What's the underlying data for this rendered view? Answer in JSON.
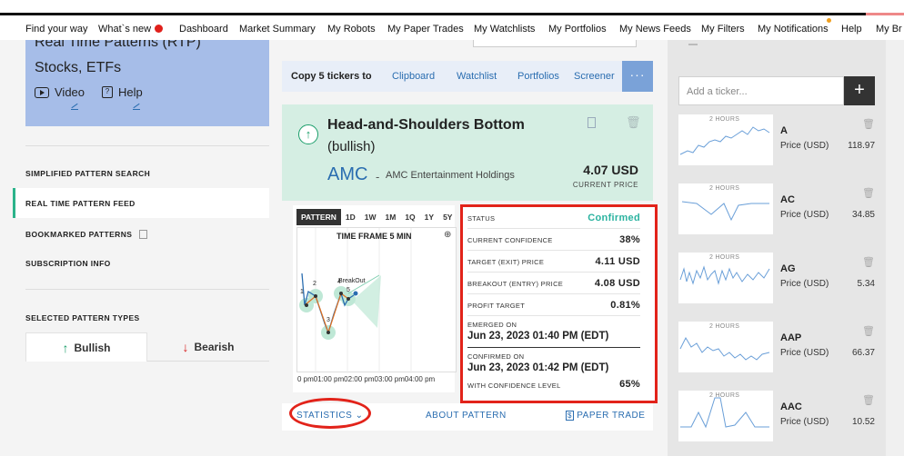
{
  "nav": {
    "items": [
      "Find your way",
      "What`s new",
      "Dashboard",
      "Market Summary",
      "My Robots",
      "My Paper Trades",
      "My Watchlists",
      "My Portfolios",
      "My News Feeds",
      "My Filters",
      "My Notifications",
      "Help",
      "My Br"
    ]
  },
  "left": {
    "card_title1": "Real Time Patterns (RTP)",
    "card_title2": "Stocks, ETFs",
    "video_label": "Video",
    "help_label": "Help",
    "menu": {
      "simplified": "SIMPLIFIED PATTERN SEARCH",
      "realtime": "REAL TIME PATTERN FEED",
      "bookmarked": "BOOKMARKED PATTERNS",
      "subscription": "SUBSCRIPTION INFO",
      "selected_types": "SELECTED PATTERN TYPES"
    },
    "bullish": "Bullish",
    "bearish": "Bearish"
  },
  "copybar": {
    "label": "Copy 5 tickers to",
    "links": [
      "Clipboard",
      "Watchlist",
      "Portfolios",
      "Screener"
    ],
    "more": "···"
  },
  "pattern": {
    "name": "Head-and-Shoulders Bottom",
    "direction": "(bullish)",
    "symbol": "AMC",
    "separator": "-",
    "company": "AMC Entertainment Holdings",
    "price": "4.07 USD",
    "price_label": "CURRENT PRICE"
  },
  "chart": {
    "tabs": [
      "PATTERN",
      "1D",
      "1W",
      "1M",
      "1Q",
      "1Y",
      "5Y"
    ],
    "selected_tab": "PATTERN",
    "timeframe": "TIME FRAME 5 MIN",
    "time_axis": "0 pm01:00 pm02:00 pm03:00 pm04:00 pm",
    "points": [
      "1",
      "2",
      "3",
      "4",
      "5"
    ],
    "breakout_label": "BreakOut"
  },
  "status": {
    "status_label": "STATUS",
    "status_value": "Confirmed",
    "confidence_label": "CURRENT CONFIDENCE",
    "confidence_value": "38%",
    "target_label": "TARGET (EXIT) PRICE",
    "target_value": "4.11 USD",
    "breakout_label": "BREAKOUT (ENTRY) PRICE",
    "breakout_value": "4.08 USD",
    "profit_label": "PROFIT TARGET",
    "profit_value": "0.81%",
    "emerged_label": "EMERGED ON",
    "emerged_value": "Jun 23, 2023 01:40 PM (EDT)",
    "confirmed_label": "CONFIRMED ON",
    "confirmed_value": "Jun 23, 2023 01:42 PM (EDT)",
    "conf_level_label": "WITH CONFIDENCE LEVEL",
    "conf_level_value": "65%"
  },
  "bottom": {
    "statistics": "STATISTICS",
    "about": "ABOUT PATTERN",
    "paper_trade": "PAPER TRADE"
  },
  "right": {
    "add_placeholder": "Add a ticker...",
    "add_button": "+",
    "price_label": "Price (USD)",
    "hours_label": "2 HOURS",
    "tickers": [
      {
        "symbol": "A",
        "price": "118.97"
      },
      {
        "symbol": "AC",
        "price": "34.85"
      },
      {
        "symbol": "AG",
        "price": "5.34"
      },
      {
        "symbol": "AAP",
        "price": "66.37"
      },
      {
        "symbol": "AAC",
        "price": "10.52"
      }
    ]
  },
  "colors": {
    "accent_blue": "#2a6db0",
    "bullish_green": "#1a9e6a",
    "bearish_red": "#d82020",
    "highlight_red": "#e2231a",
    "confirmed_teal": "#2bb3a0"
  }
}
